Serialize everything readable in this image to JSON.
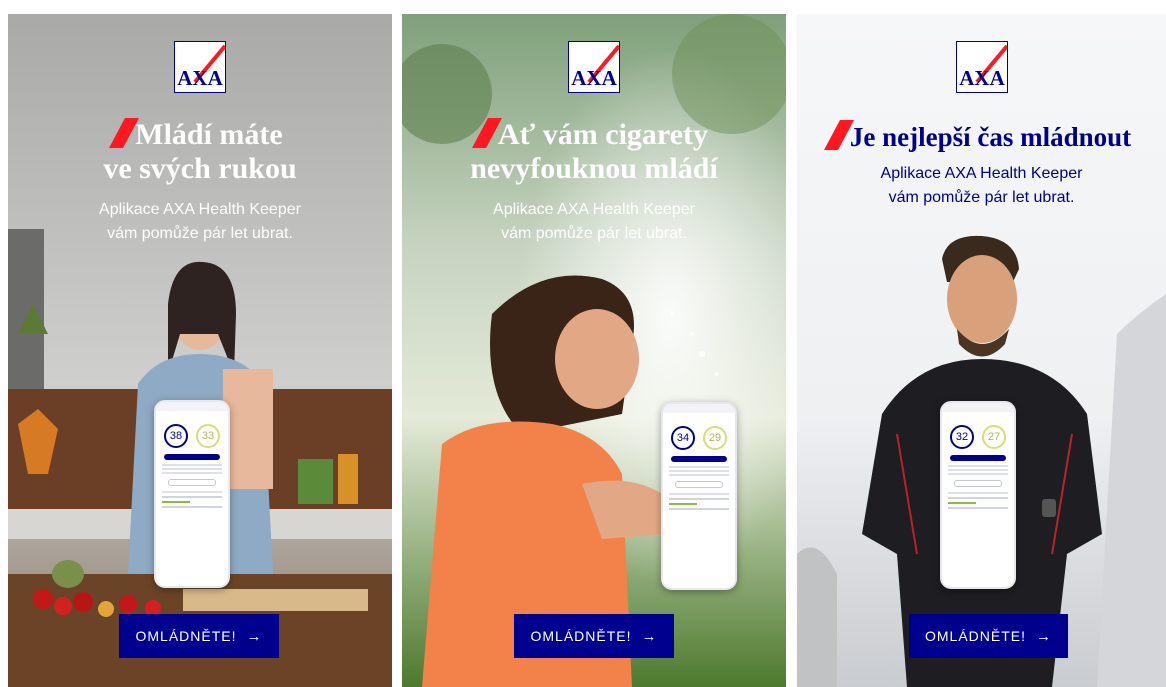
{
  "brand": {
    "logo_text": "AXA",
    "color": "#00008f",
    "accent": "#ff1721"
  },
  "panels": [
    {
      "headline_line1": "Mládí máte",
      "headline_line2": "ve svých rukou",
      "sub_line1": "Aplikace AXA Health Keeper",
      "sub_line2": "vám pomůže pár let ubrat.",
      "ring_age": "38",
      "ring_target": "33",
      "cta": "OMLÁDNĚTE!",
      "cta_icon": "arrow-right-icon",
      "scene": "kitchen woman"
    },
    {
      "headline_line1": "Ať vám cigarety",
      "headline_line2": "nevyfouknou mládí",
      "sub_line1": "Aplikace AXA Health Keeper",
      "sub_line2": "vám pomůže pár let ubrat.",
      "ring_age": "34",
      "ring_target": "29",
      "cta": "OMLÁDNĚTE!",
      "cta_icon": "arrow-right-icon",
      "scene": "woman blowing dandelion"
    },
    {
      "headline_line1": "Je nejlepší čas mládnout",
      "sub_line1": "Aplikace AXA Health Keeper",
      "sub_line2": "vám pomůže pár let ubrat.",
      "ring_age": "32",
      "ring_target": "27",
      "cta": "OMLÁDNĚTE!",
      "cta_icon": "arrow-right-icon",
      "scene": "running man"
    }
  ]
}
